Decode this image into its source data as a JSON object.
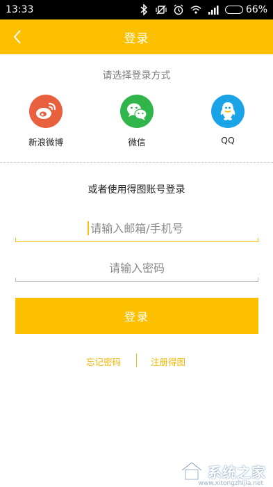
{
  "status_bar": {
    "time": "13:33",
    "battery": "66%",
    "battery_level": 0.66
  },
  "header": {
    "title": "登录"
  },
  "social": {
    "prompt": "请选择登录方式",
    "items": [
      {
        "label": "新浪微博",
        "color": "#e9603f",
        "icon": "weibo-icon"
      },
      {
        "label": "微信",
        "color": "#2fb54a",
        "icon": "wechat-icon"
      },
      {
        "label": "QQ",
        "color": "#1aa3e6",
        "icon": "qq-icon"
      }
    ]
  },
  "alt_prompt": "或者使用得图账号登录",
  "form": {
    "account_placeholder": "请输入邮箱/手机号",
    "password_placeholder": "请输入密码",
    "login_label": "登录"
  },
  "links": {
    "forgot": "忘记密码",
    "register": "注册得图"
  },
  "watermark": {
    "text": "系统之家",
    "url": "www.xitongzhijia.net"
  },
  "colors": {
    "accent": "#fcc000",
    "link": "#f0b400"
  }
}
